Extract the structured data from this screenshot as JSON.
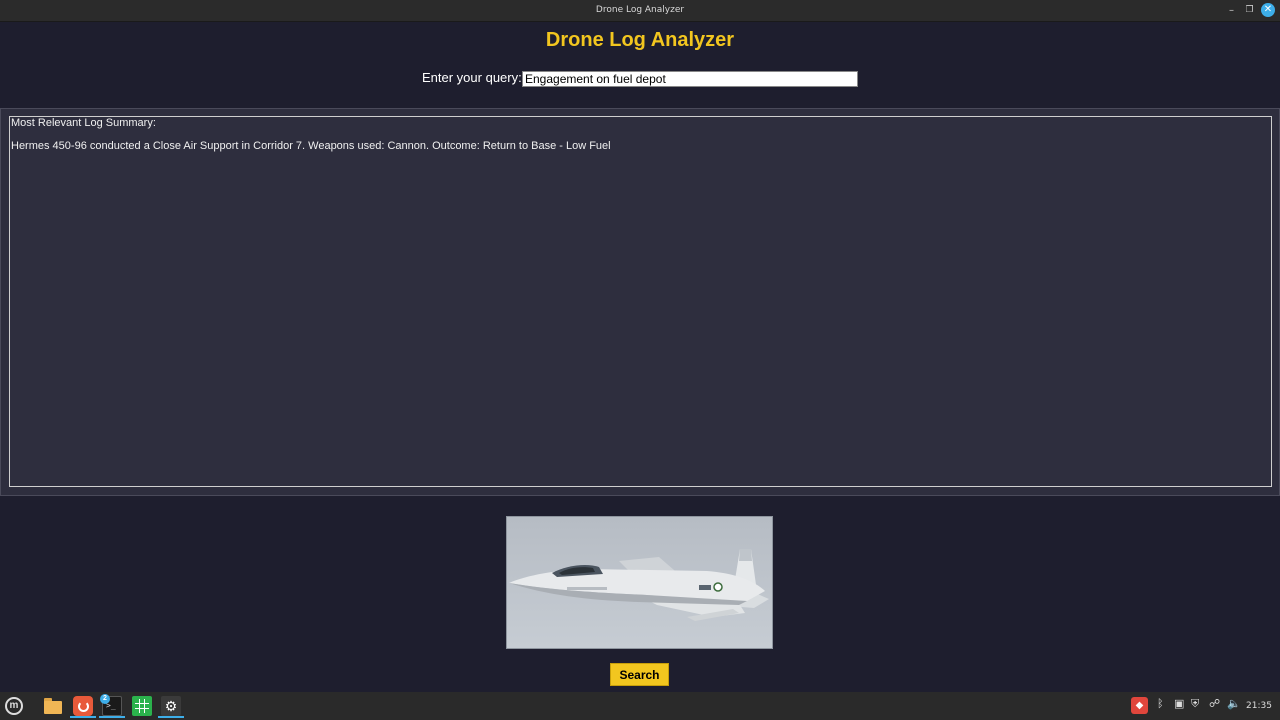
{
  "window": {
    "title": "Drone Log Analyzer",
    "minimize_glyph": "–",
    "maximize_glyph": "❐",
    "close_glyph": "✕"
  },
  "app": {
    "title": "Drone Log Analyzer",
    "title_color": "#f2c61f"
  },
  "query": {
    "label": "Enter your query:",
    "value": "Engagement on fuel depot"
  },
  "summary": {
    "heading": "Most Relevant Log Summary:",
    "text": "Hermes 450-96 conducted a Close Air Support in Corridor 7. Weapons used: Cannon. Outcome: Return to Base - Low Fuel"
  },
  "image": {
    "icon": "fighter-jet-photo"
  },
  "search_button": {
    "label": "Search"
  },
  "taskbar": {
    "terminal_badge": "2",
    "terminal_prompt": ">_",
    "clock": "21:35",
    "icons": [
      "mint-menu-icon",
      "files-icon",
      "app-red-icon",
      "terminal-icon",
      "spreadsheet-icon",
      "settings-icon"
    ],
    "tray_icons": [
      "red-app-tray-icon",
      "bluetooth-icon",
      "clipboard-icon",
      "shield-icon",
      "network-icon",
      "volume-icon"
    ]
  }
}
